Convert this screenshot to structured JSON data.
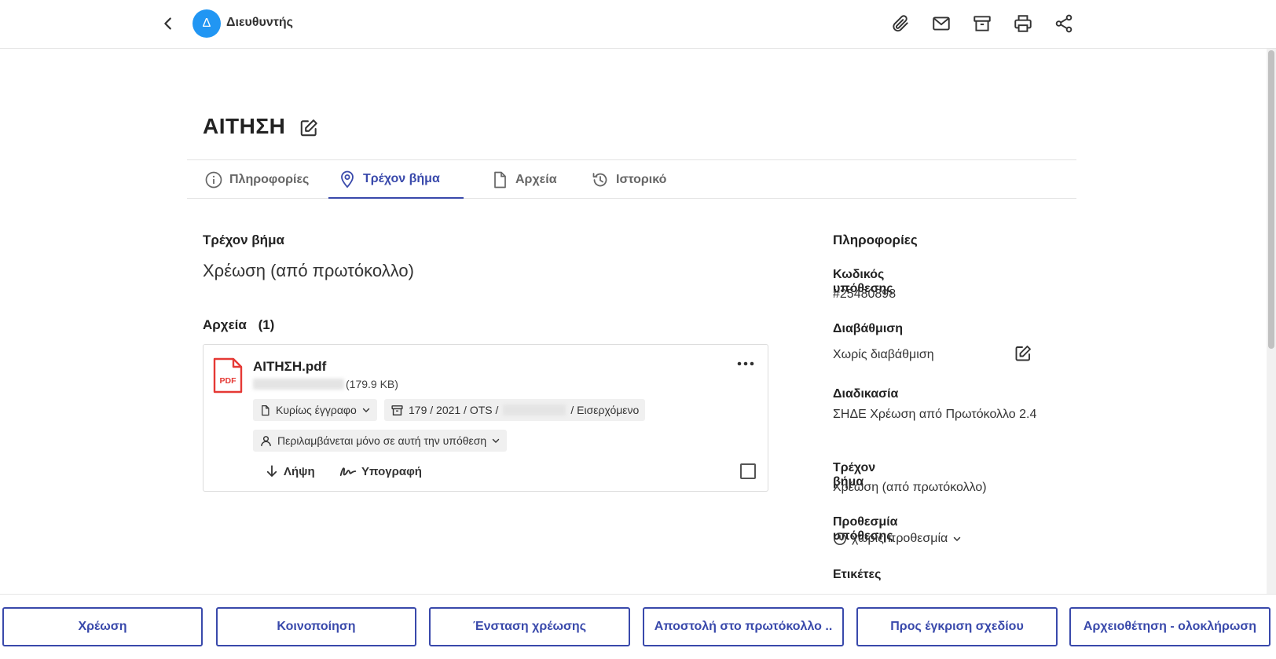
{
  "header": {
    "avatar_letter": "Δ",
    "user_name": "Διευθυντής",
    "icons": [
      "chevron-left-icon",
      "paperclip-icon",
      "mail-icon",
      "archive-icon",
      "printer-icon",
      "share-icon"
    ]
  },
  "page": {
    "title": "ΑΙΤΗΣΗ"
  },
  "tabs": [
    {
      "label": "Πληροφορίες",
      "icon": "info-icon",
      "active": false
    },
    {
      "label": "Τρέχον βήμα",
      "icon": "location-pin-icon",
      "active": true
    },
    {
      "label": "Αρχεία",
      "icon": "file-icon",
      "active": false
    },
    {
      "label": "Ιστορικό",
      "icon": "history-icon",
      "active": false
    }
  ],
  "main": {
    "current_step_label": "Τρέχον βήμα",
    "current_step_value": "Χρέωση (από πρωτόκολλο)",
    "files_label": "Αρχεία",
    "files_count": "(1)"
  },
  "file": {
    "type_badge": "PDF",
    "name": "ΑΙΤΗΣΗ.pdf",
    "size": "(179.9 KB)",
    "doc_type": "Κυρίως έγγραφο",
    "protocol_prefix": "179 / 2021 / OTS /",
    "protocol_suffix": "/ Εισερχόμενο",
    "inclusion": "Περιλαμβάνεται μόνο σε αυτή την υπόθεση",
    "download_label": "Λήψη",
    "sign_label": "Υπογραφή"
  },
  "sidebar": {
    "title": "Πληροφορίες",
    "case_code_label": "Κωδικός υπόθεσης",
    "case_code_value": "#25480898",
    "classification_label": "Διαβάθμιση",
    "classification_value": "Χωρίς διαβάθμιση",
    "procedure_label": "Διαδικασία",
    "procedure_value": "ΣΗΔΕ Χρέωση από Πρωτόκολλο 2.4",
    "step_label": "Τρέχον βήμα",
    "step_value": "Χρέωση (από πρωτόκολλο)",
    "deadline_label": "Προθεσμία υπόθεσης",
    "deadline_value": "χωρίς προθεσμία",
    "tags_label": "Ετικέτες"
  },
  "actions": [
    "Χρέωση",
    "Κοινοποίηση",
    "Ένσταση χρέωσης",
    "Αποστολή στο πρωτόκολλο ..",
    "Προς έγκριση σχεδίου",
    "Αρχειοθέτηση - ολοκλήρωση"
  ],
  "colors": {
    "accent": "#3949ab",
    "avatar": "#2196f3",
    "pdf_red": "#e53935"
  }
}
